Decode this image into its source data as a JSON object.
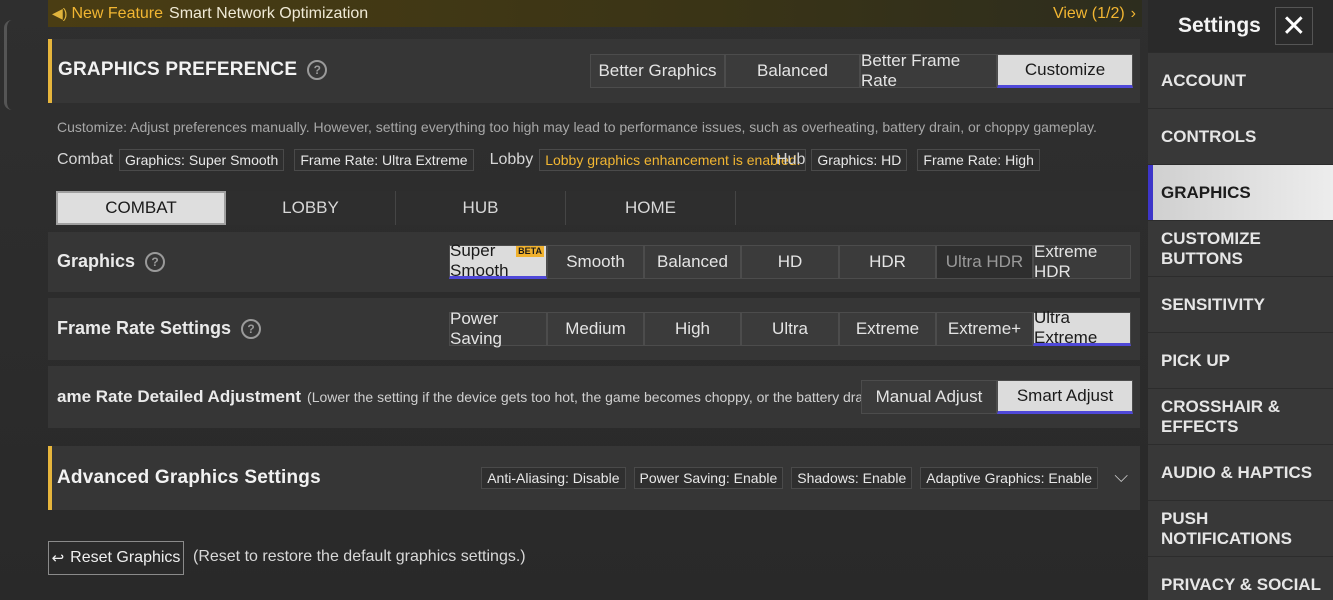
{
  "banner": {
    "speaker_icon": "speaker-icon",
    "new_feature": "New Feature",
    "title": "Smart Network Optimization",
    "view": "View (1/2)"
  },
  "graphics_preference": {
    "title": "GRAPHICS PREFERENCE",
    "options": [
      "Better Graphics",
      "Balanced",
      "Better Frame Rate",
      "Customize"
    ],
    "selected": "Customize",
    "description": "Customize: Adjust preferences manually. However, setting everything too high may lead to performance issues, such as overheating, battery drain, or choppy gameplay."
  },
  "summary": {
    "combat_label": "Combat",
    "combat_graphics": "Graphics: Super Smooth",
    "combat_frame_rate": "Frame Rate: Ultra Extreme",
    "lobby_label": "Lobby",
    "lobby_text": "Lobby graphics enhancement is enabled.",
    "hub_label": "Hub",
    "hub_graphics": "Graphics: HD",
    "hub_frame_rate": "Frame Rate: High"
  },
  "mode_tabs": [
    "COMBAT",
    "LOBBY",
    "HUB",
    "HOME"
  ],
  "mode_selected": "COMBAT",
  "graphics": {
    "label": "Graphics",
    "options": [
      "Super Smooth",
      "Smooth",
      "Balanced",
      "HD",
      "HDR",
      "Ultra HDR",
      "Extreme HDR"
    ],
    "selected": "Super Smooth",
    "beta_badge": "BETA"
  },
  "frame_rate": {
    "label": "Frame Rate Settings",
    "options": [
      "Power Saving",
      "Medium",
      "High",
      "Ultra",
      "Extreme",
      "Extreme+",
      "Ultra Extreme"
    ],
    "selected": "Ultra Extreme"
  },
  "detailed": {
    "label": "ame Rate Detailed Adjustment",
    "hint": "(Lower the setting if the device gets too hot, the game becomes choppy, or the battery drains too quickly.)",
    "options": [
      "Manual Adjust",
      "Smart Adjust"
    ],
    "selected": "Smart Adjust"
  },
  "advanced": {
    "title": "Advanced Graphics Settings",
    "tags": [
      "Anti-Aliasing: Disable",
      "Power Saving: Enable",
      "Shadows: Enable",
      "Adaptive Graphics: Enable"
    ]
  },
  "reset": {
    "button": "Reset Graphics",
    "hint": "(Reset to restore the default graphics settings.)"
  },
  "sidebar": {
    "title": "Settings",
    "items": [
      "ACCOUNT",
      "CONTROLS",
      "GRAPHICS",
      "CUSTOMIZE BUTTONS",
      "SENSITIVITY",
      "PICK UP",
      "CROSSHAIR & EFFECTS",
      "AUDIO & HAPTICS",
      "PUSH NOTIFICATIONS",
      "PRIVACY & SOCIAL"
    ],
    "selected": "GRAPHICS"
  },
  "colors": {
    "accent_yellow": "#f2b632",
    "selected_underline": "#4f48d8",
    "selected_bg": "#dcdcdc"
  }
}
